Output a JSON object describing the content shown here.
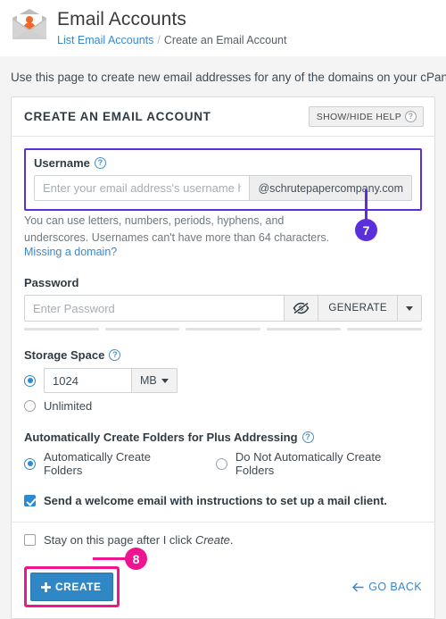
{
  "header": {
    "icon": "email-envelope-user-icon",
    "title": "Email Accounts",
    "breadcrumb_link": "List Email Accounts",
    "breadcrumb_separator": "/",
    "breadcrumb_current": "Create an Email Account"
  },
  "intro": {
    "text": "Use this page to create new email addresses for any of the domains on your cPanel accoun"
  },
  "card": {
    "title": "CREATE AN EMAIL ACCOUNT",
    "help_toggle": "SHOW/HIDE HELP",
    "help_icon": "question-circle-icon"
  },
  "username": {
    "label": "Username",
    "help_icon": "question-circle-icon",
    "placeholder": "Enter your email address's username here.",
    "value": "",
    "domain": "@schrutepapercompany.com",
    "hint_line1": "You can use letters, numbers, periods, hyphens, and",
    "hint_line2": "underscores. Usernames can't have more than 64 characters.",
    "missing_domain_link": "Missing a domain?"
  },
  "password": {
    "label": "Password",
    "placeholder": "Enter Password",
    "value": "",
    "toggle_icon": "eye-slash-icon",
    "generate_label": "GENERATE",
    "caret_icon": "chevron-down-icon",
    "strength_segments": 5,
    "strength_filled": 0
  },
  "storage": {
    "label": "Storage Space",
    "help_icon": "question-circle-icon",
    "value": "1024",
    "unit": "MB",
    "unit_caret_icon": "chevron-down-icon",
    "limited_selected": true,
    "unlimited_label": "Unlimited",
    "unlimited_selected": false
  },
  "plus_addressing": {
    "label": "Automatically Create Folders for Plus Addressing",
    "help_icon": "question-circle-icon",
    "option_yes": "Automatically Create Folders",
    "option_no": "Do Not Automatically Create Folders",
    "selected": "yes"
  },
  "welcome_email": {
    "label": "Send a welcome email with instructions to set up a mail client.",
    "checked": true
  },
  "stay_on_page": {
    "label_before": "Stay on this page after I click ",
    "label_italic": "Create",
    "label_after": ".",
    "checked": false
  },
  "footer": {
    "create_label": "CREATE",
    "create_plus_icon": "plus-icon",
    "go_back_label": "GO BACK",
    "go_back_icon": "arrow-left-icon"
  },
  "annotations": [
    {
      "number": "7",
      "color": "#5b2fdb",
      "target": "username-field"
    },
    {
      "number": "8",
      "color": "#ef1490",
      "target": "create-button"
    }
  ],
  "colors": {
    "annotation_purple": "#5b2fdb",
    "annotation_pink": "#ef1490",
    "primary_button": "#3087c6",
    "link": "#3a87cd",
    "accent_orange": "#f0662b"
  }
}
